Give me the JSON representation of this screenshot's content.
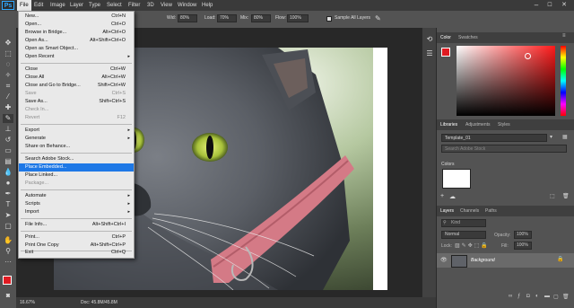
{
  "app": {
    "logo": "Ps"
  },
  "menubar": {
    "items": [
      "File",
      "Edit",
      "Image",
      "Layer",
      "Type",
      "Select",
      "Filter",
      "3D",
      "View",
      "Window",
      "Help"
    ],
    "active": "File"
  },
  "window_controls": {
    "minimize": "–",
    "maximize": "☐",
    "close": "✕"
  },
  "options": {
    "wid_label": "Wid:",
    "wid_value": "80%",
    "load_label": "Load:",
    "load_value": "70%",
    "mix_label": "Mix:",
    "mix_value": "80%",
    "flow_label": "Flow:",
    "flow_value": "100%",
    "sample_label": "Sample All Layers"
  },
  "file_menu": {
    "items": [
      {
        "label": "New...",
        "shortcut": "Ctrl+N"
      },
      {
        "label": "Open...",
        "shortcut": "Ctrl+O"
      },
      {
        "label": "Browse in Bridge...",
        "shortcut": "Alt+Ctrl+O"
      },
      {
        "label": "Open As...",
        "shortcut": "Alt+Shift+Ctrl+O"
      },
      {
        "label": "Open as Smart Object...",
        "shortcut": ""
      },
      {
        "label": "Open Recent",
        "shortcut": ""
      },
      {
        "label": "Close",
        "shortcut": "Ctrl+W"
      },
      {
        "label": "Close All",
        "shortcut": "Alt+Ctrl+W"
      },
      {
        "label": "Close and Go to Bridge...",
        "shortcut": "Shift+Ctrl+W"
      },
      {
        "label": "Save",
        "shortcut": "Ctrl+S"
      },
      {
        "label": "Save As...",
        "shortcut": "Shift+Ctrl+S"
      },
      {
        "label": "Check In...",
        "shortcut": ""
      },
      {
        "label": "Revert",
        "shortcut": "F12"
      },
      {
        "label": "Export",
        "shortcut": ""
      },
      {
        "label": "Generate",
        "shortcut": ""
      },
      {
        "label": "Share on Behance...",
        "shortcut": ""
      },
      {
        "label": "Search Adobe Stock...",
        "shortcut": ""
      },
      {
        "label": "Place Embedded...",
        "shortcut": ""
      },
      {
        "label": "Place Linked...",
        "shortcut": ""
      },
      {
        "label": "Package...",
        "shortcut": ""
      },
      {
        "label": "Automate",
        "shortcut": ""
      },
      {
        "label": "Scripts",
        "shortcut": ""
      },
      {
        "label": "Import",
        "shortcut": ""
      },
      {
        "label": "File Info...",
        "shortcut": "Alt+Shift+Ctrl+I"
      },
      {
        "label": "Print...",
        "shortcut": "Ctrl+P"
      },
      {
        "label": "Print One Copy",
        "shortcut": "Alt+Shift+Ctrl+P"
      },
      {
        "label": "Exit",
        "shortcut": "Ctrl+Q"
      }
    ],
    "highlighted": "Place Embedded..."
  },
  "color_panel": {
    "tabs": [
      "Color",
      "Swatches"
    ],
    "fg_color": "#e01b22",
    "hue_color": "#ff1a1a"
  },
  "libraries_panel": {
    "tabs": [
      "Libraries",
      "Adjustments",
      "Styles"
    ],
    "library_name": "Template_01",
    "search_placeholder": "Search Adobe Stock",
    "group_label": "Colors"
  },
  "layers_panel": {
    "tabs": [
      "Layers",
      "Channels",
      "Paths"
    ],
    "kind_label": "Kind",
    "mode_value": "Normal",
    "opacity_label": "Opacity:",
    "opacity_value": "100%",
    "lock_label": "Lock:",
    "fill_label": "Fill:",
    "fill_value": "100%",
    "layer_name": "Background"
  },
  "status": {
    "zoom": "16.67%",
    "doc": "Doc: 45.8M/45.8M"
  }
}
